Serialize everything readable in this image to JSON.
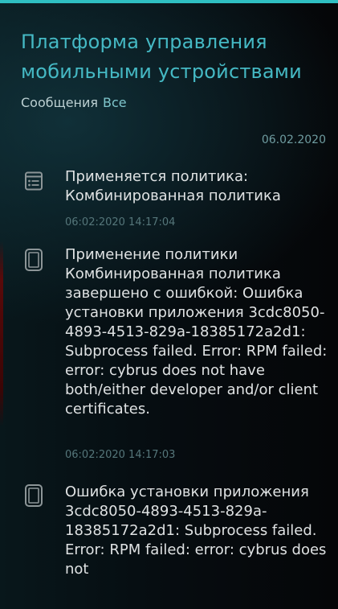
{
  "header": {
    "title": "Платформа управления мобильными устройствами",
    "section": "Сообщения",
    "filter": "Все"
  },
  "date_header": "06.02.2020",
  "messages": [
    {
      "icon": "list-icon",
      "text": "Применяется политика: Комбинированная политика",
      "time": "06:02:2020 14:17:04"
    },
    {
      "icon": "phone-icon",
      "text": "Применение политики Комбинированная политика завершено с ошибкой: Ошибка установки приложения 3cdc8050-4893-4513-829a-18385172a2d1: Subprocess failed. Error: RPM failed: error: cybrus does not have both/either developer and/or client certificates.",
      "time": "06:02:2020 14:17:03"
    },
    {
      "icon": "phone-icon",
      "text": "Ошибка установки приложения 3cdc8050-4893-4513-829a-18385172a2d1: Subprocess failed. Error: RPM failed: error: cybrus does not"
    }
  ],
  "colors": {
    "accent": "#2fbfc2",
    "title": "#45b9c4",
    "time": "#55767a"
  }
}
